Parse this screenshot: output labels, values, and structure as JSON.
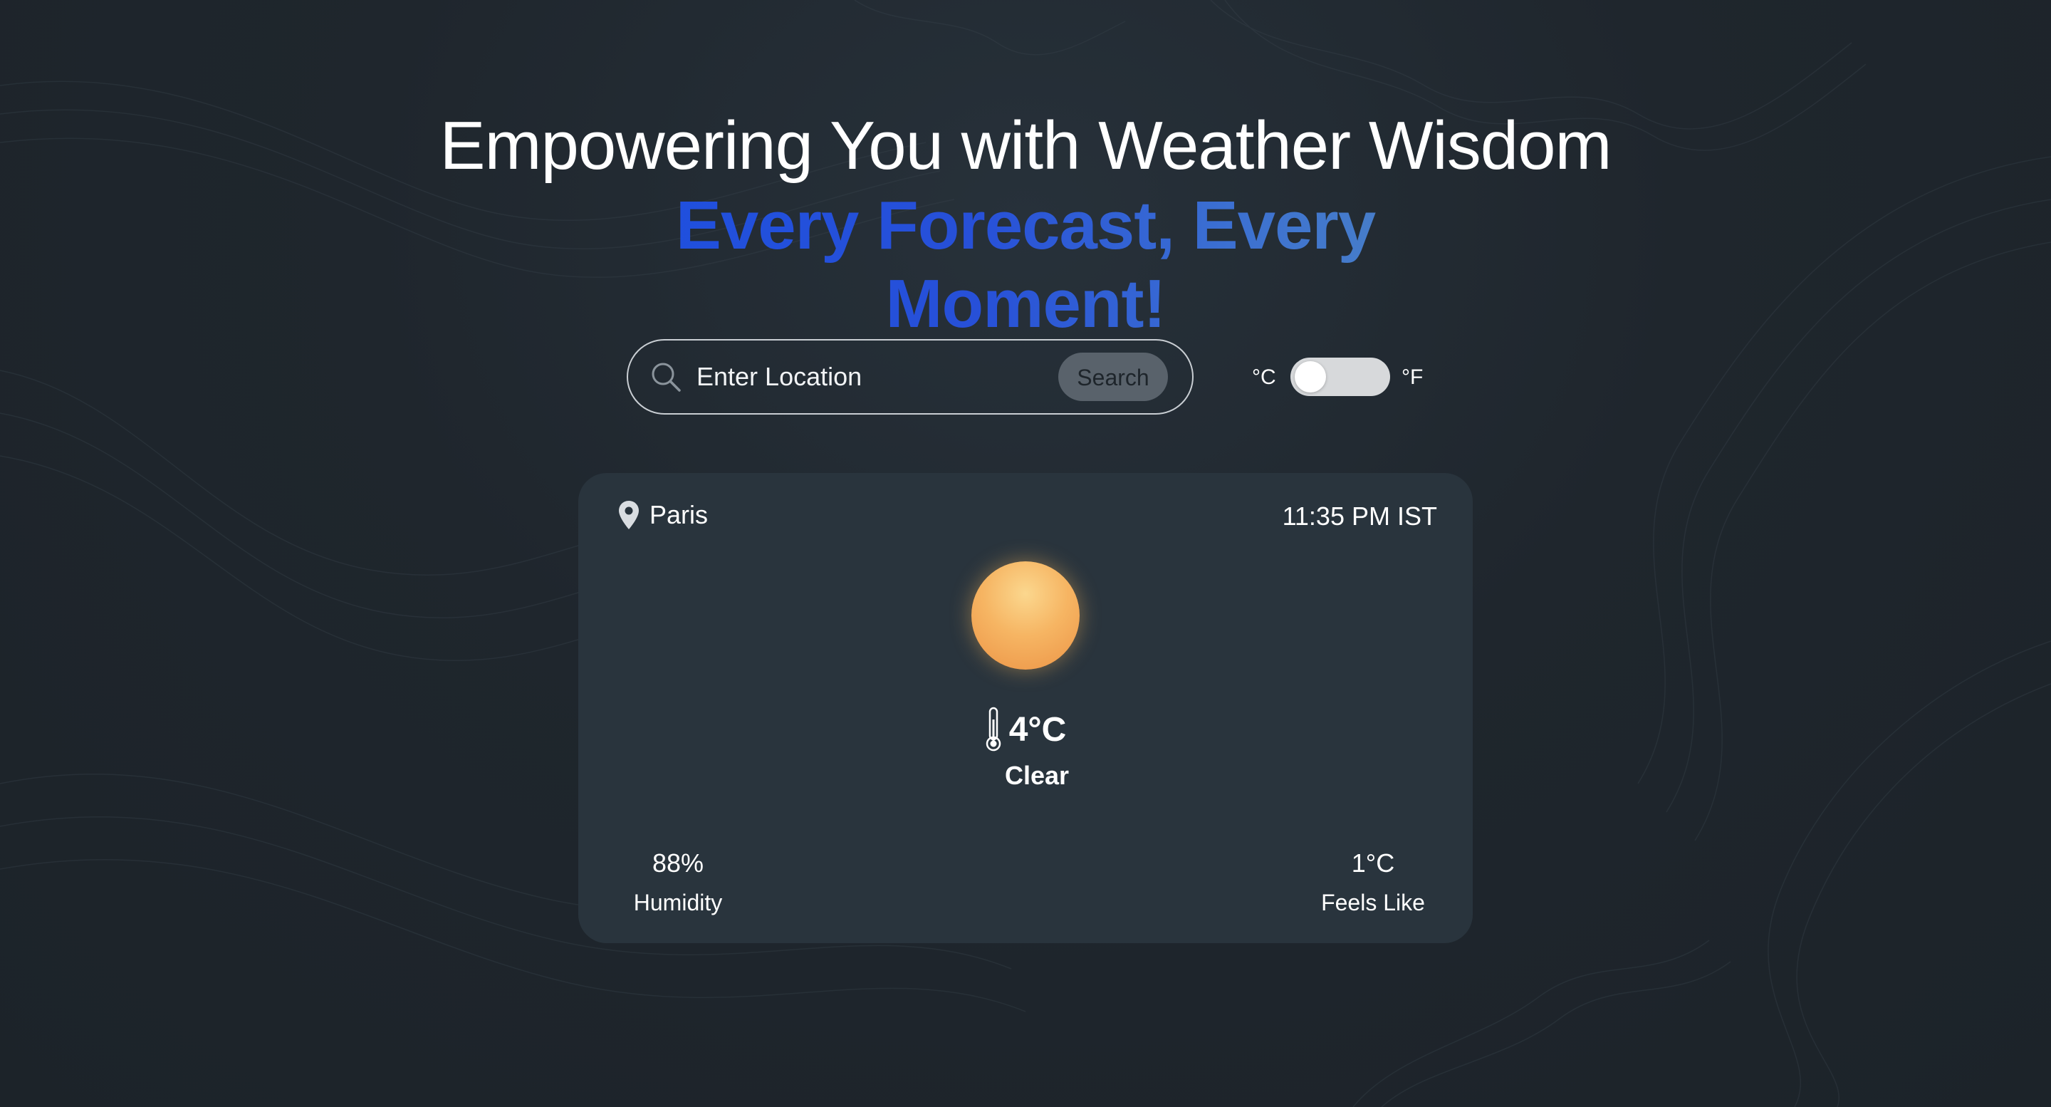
{
  "hero": {
    "line1": "Empowering You with Weather Wisdom",
    "line2": "Every Forecast, Every Moment!"
  },
  "search": {
    "placeholder": "Enter Location",
    "button_label": "Search"
  },
  "units": {
    "celsius_label": "°C",
    "fahrenheit_label": "°F",
    "selected": "°C"
  },
  "weather": {
    "location": "Paris",
    "time": "11:35 PM IST",
    "temperature": "4°C",
    "condition": "Clear",
    "humidity_value": "88%",
    "humidity_label": "Humidity",
    "feels_like_value": "1°C",
    "feels_like_label": "Feels Like",
    "icon": "sun-icon"
  },
  "colors": {
    "background": "#1f262d",
    "card": "#29343d",
    "accent_blue": "#1d4fe0",
    "accent_blue_light": "#5089c2",
    "sun_orange": "#ec9446"
  }
}
